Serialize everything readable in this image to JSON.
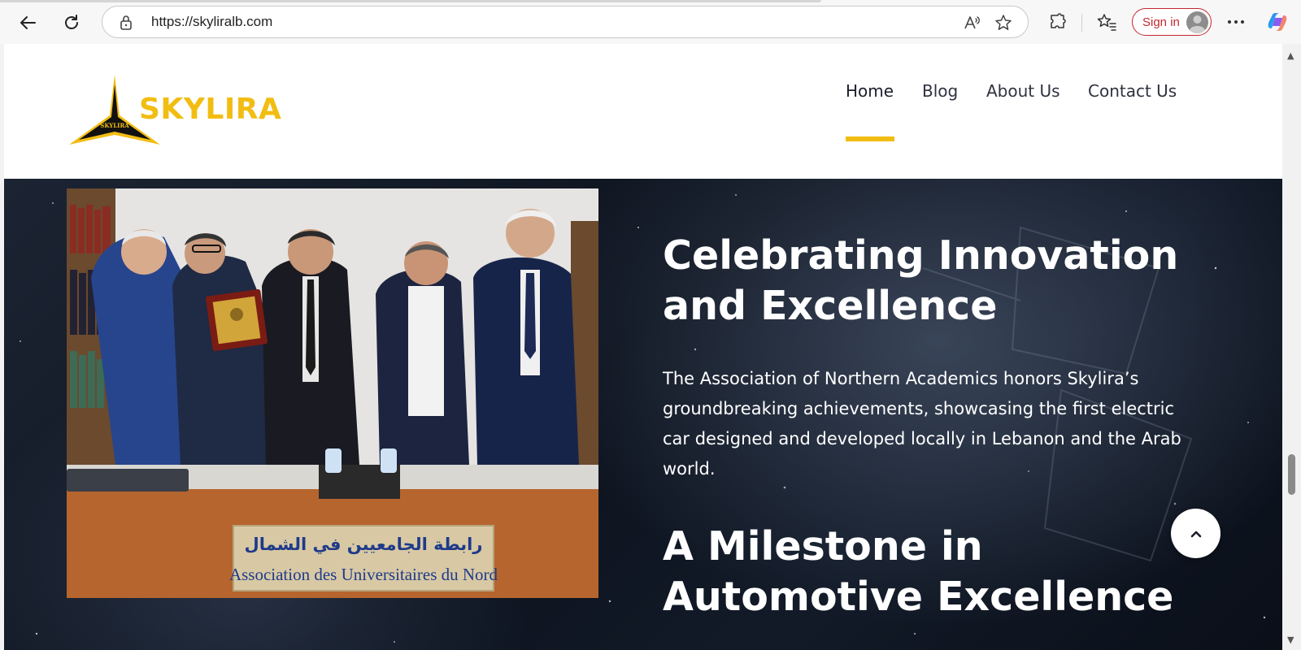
{
  "browser": {
    "url": "https://skyliralb.com",
    "signin_label": "Sign in"
  },
  "header": {
    "logo_text": "SKYLIRA",
    "logo_small_text": "SKYLIRA",
    "nav": [
      {
        "label": "Home",
        "active": true
      },
      {
        "label": "Blog",
        "active": false
      },
      {
        "label": "About Us",
        "active": false
      },
      {
        "label": "Contact Us",
        "active": false
      }
    ]
  },
  "hero": {
    "heading_1_line_1": "Celebrating Innovation",
    "heading_1_line_2": "and Excellence",
    "paragraph": "The Association of Northern Academics honors Skylira’s groundbreaking achievements, showcasing the first electric car designed and developed locally in Lebanon and the Arab world.",
    "heading_2_line_1": "A Milestone in",
    "heading_2_line_2": "Automotive Excellence",
    "photo": {
      "plaque_arabic": "رابطة الجامعيين في الشمال",
      "plaque_french": "Association des Universitaires du Nord"
    }
  },
  "colors": {
    "accent": "#f2bd13",
    "nav_text": "#2f3140",
    "signin": "#c2282f",
    "hero_bg": "#0d131e"
  },
  "icons": [
    "back-arrow-icon",
    "refresh-icon",
    "lock-icon",
    "read-aloud-icon",
    "favorite-star-icon",
    "extensions-icon",
    "favorites-icon",
    "more-icon",
    "copilot-icon",
    "chevron-up-icon"
  ]
}
